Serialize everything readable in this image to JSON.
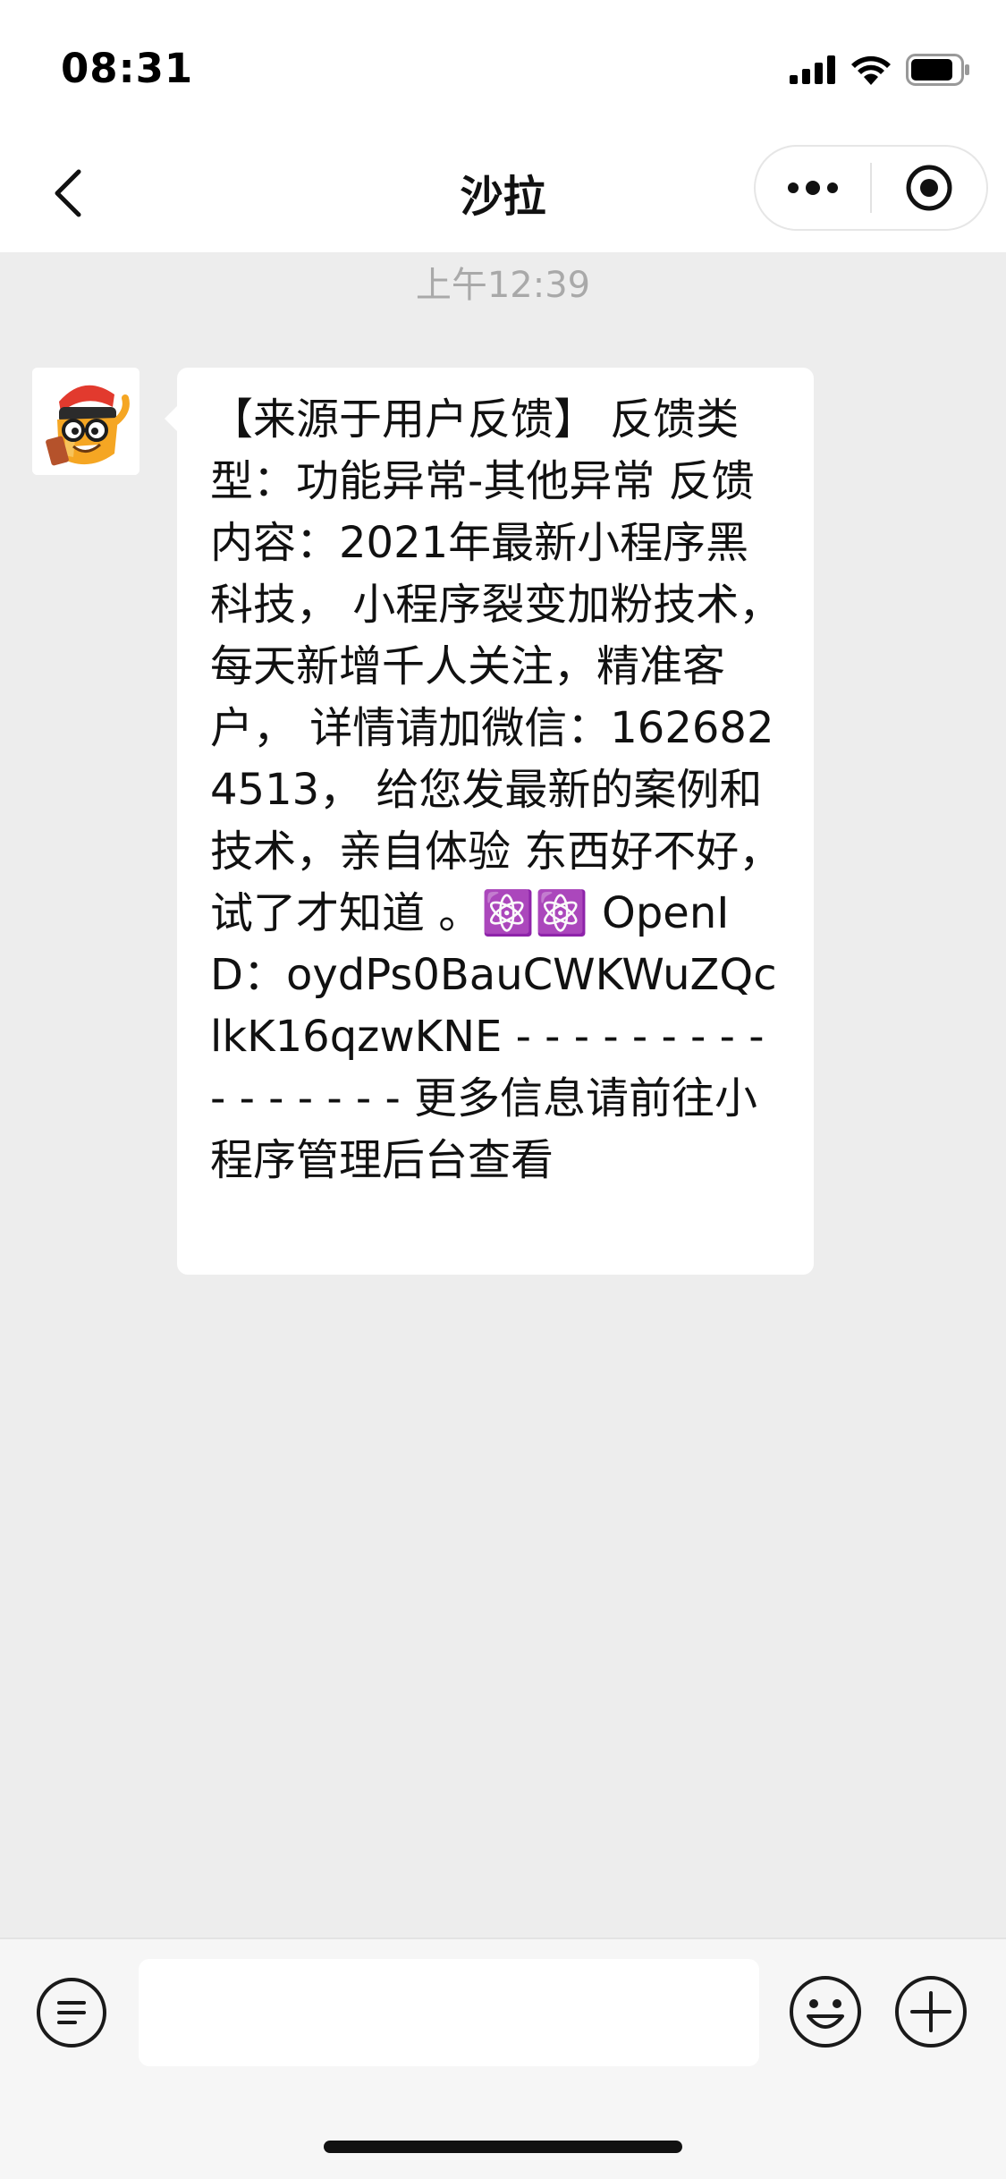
{
  "status_bar": {
    "time": "08:31"
  },
  "nav": {
    "title": "沙拉",
    "back_icon": "chevron-left-icon",
    "more_icon": "more-dots-icon",
    "close_icon": "target-circle-icon"
  },
  "chat": {
    "timestamp": "上午12:39",
    "messages": [
      {
        "sender": "other",
        "avatar_icon": "cartoon-pencil-avatar",
        "text": "【来源于用户反馈】 反馈类型：功能异常-其他异常 反馈内容：2021年最新小程序黑科技， 小程序裂变加粉技术， 每天新增千人关注，精准客户， 详情请加微信：1626824513， 给您发最新的案例和技术，亲自体验 东西好不好，试了才知道 。⚛️⚛️ OpenID：oydPs0BauCWKWuZQclkK16qzwKNE - - - - - - - - - - - - - - - - 更多信息请前往小程序管理后台查看"
      }
    ]
  },
  "input_bar": {
    "text_value": "",
    "placeholder": ""
  },
  "colors": {
    "background": "#ededed",
    "bar": "#ffffff",
    "timestamp": "#a9a9a9",
    "text": "#111111"
  }
}
